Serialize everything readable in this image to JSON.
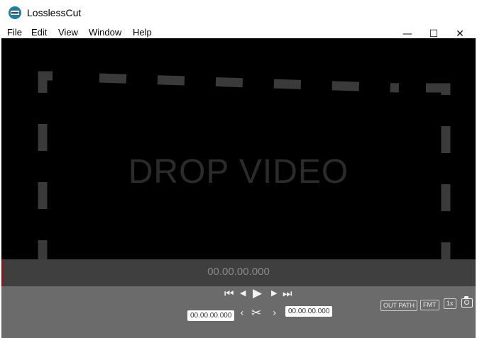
{
  "window": {
    "title": "LosslessCut"
  },
  "menu": [
    "File",
    "Edit",
    "View",
    "Window",
    "Help"
  ],
  "window_controls": {
    "minimize": "—",
    "maximize": "☐",
    "close": "✕"
  },
  "video": {
    "placeholder": "DROP VIDEO"
  },
  "timeline": {
    "current_time": "00.00.00.000"
  },
  "controls": {
    "cut_start": "00.00.00.000",
    "cut_end": "00.00.00.000",
    "out_path": "OUT PATH",
    "format": "FMT",
    "speed": "1x"
  },
  "icons": [
    "app-icon",
    "jump-start-icon",
    "step-back-icon",
    "play-icon",
    "step-forward-icon",
    "jump-end-icon",
    "set-start-icon",
    "scissors-icon",
    "set-end-icon",
    "camera-icon"
  ],
  "colors": {
    "video_bg": "#000000",
    "timeline_bg": "#3f3f3f",
    "controls_bg": "#6b6b6b",
    "cursor": "#8b1a1a"
  }
}
